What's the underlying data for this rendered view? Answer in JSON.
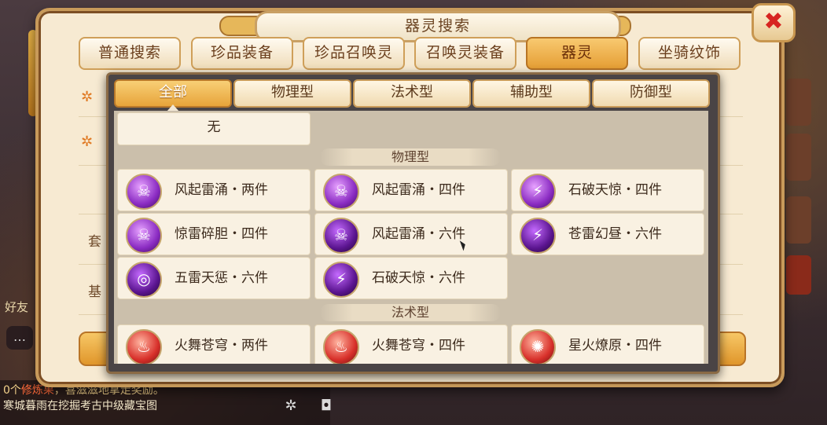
{
  "dialog": {
    "title": "器灵搜索",
    "close_glyph": "✖"
  },
  "categories": [
    {
      "label": "普通搜索"
    },
    {
      "label": "珍品装备"
    },
    {
      "label": "珍品召唤灵"
    },
    {
      "label": "召唤灵装备"
    },
    {
      "label": "器灵",
      "active": true
    },
    {
      "label": "坐骑纹饰"
    }
  ],
  "form_labels": {
    "row1": "套",
    "row2": "基"
  },
  "filter_tabs": [
    {
      "label": "全部",
      "active": true
    },
    {
      "label": "物理型"
    },
    {
      "label": "法术型"
    },
    {
      "label": "辅助型"
    },
    {
      "label": "防御型"
    }
  ],
  "none_option": {
    "label": "无"
  },
  "sections": [
    {
      "title": "物理型",
      "items": [
        {
          "label": "风起雷涌・两件",
          "icon": "ghost-purple-icon"
        },
        {
          "label": "风起雷涌・四件",
          "icon": "ghost-purple-icon"
        },
        {
          "label": "石破天惊・四件",
          "icon": "lightning-purple-icon"
        },
        {
          "label": "惊雷碎胆・四件",
          "icon": "skull-purple-icon"
        },
        {
          "label": "风起雷涌・六件",
          "icon": "ghost-dark-icon"
        },
        {
          "label": "苍雷幻昼・六件",
          "icon": "orb-lightning-icon"
        },
        {
          "label": "五雷天惩・六件",
          "icon": "thunder-halo-icon"
        },
        {
          "label": "石破天惊・六件",
          "icon": "lightning-dark-icon"
        }
      ]
    },
    {
      "title": "法术型",
      "items": [
        {
          "label": "火舞苍穹・两件",
          "icon": "fire-spirit-icon"
        },
        {
          "label": "火舞苍穹・四件",
          "icon": "fire-spirit-icon"
        },
        {
          "label": "星火燎原・四件",
          "icon": "flame-swirl-icon"
        }
      ]
    }
  ],
  "chat": {
    "line1_prefix": "0个",
    "line1_highlight": "修炼果",
    "line1_rest": "，喜滋滋地拿走奖励。",
    "line2_highlight": "",
    "line2_rest": "寒城暮雨在挖掘考古中级藏宝图",
    "friends": "好友"
  },
  "colors": {
    "accent": "#e7a43a",
    "panel": "#4a4445",
    "item_bg": "#f9f1e2",
    "text": "#3c2a1c",
    "close_red": "#d72420"
  }
}
